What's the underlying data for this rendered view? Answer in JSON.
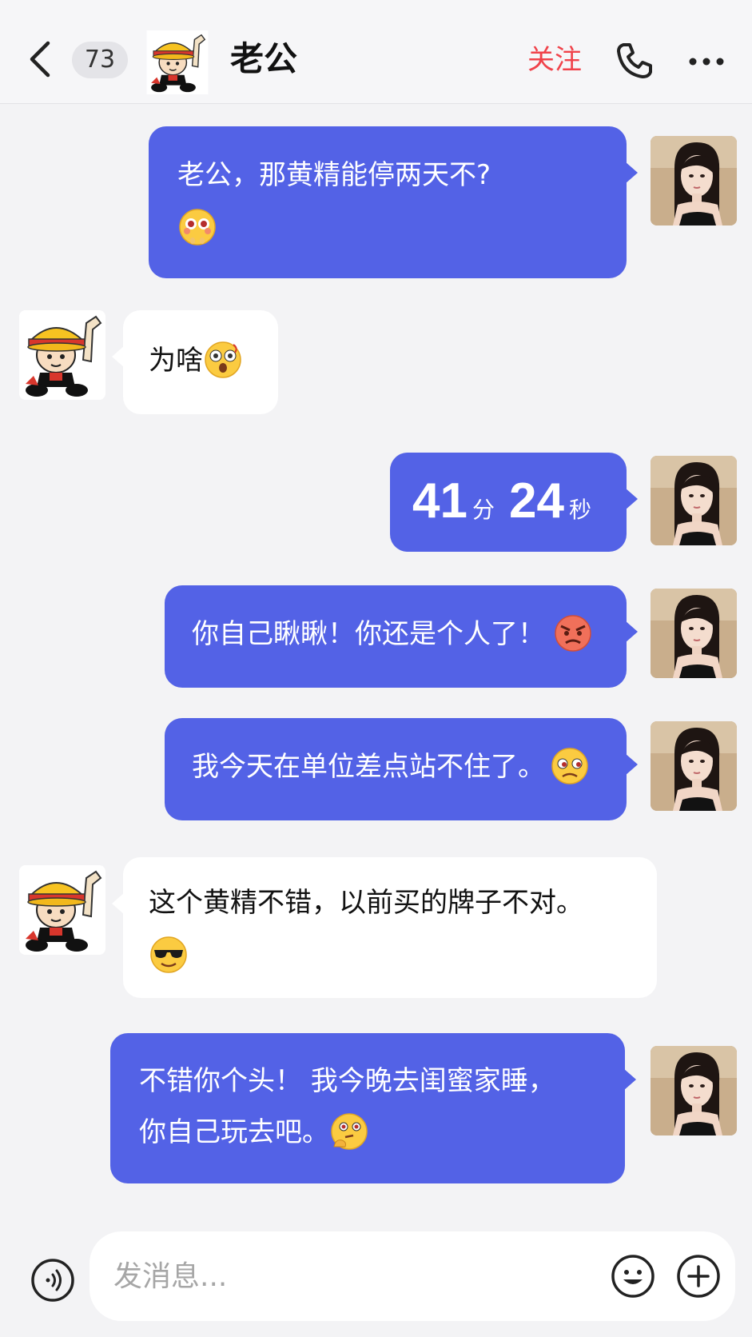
{
  "header": {
    "unread_count": "73",
    "title": "老公",
    "follow_label": "关注"
  },
  "messages": [
    {
      "sender": "me",
      "lines": [
        "老公，那黄精能停两天不?"
      ],
      "emoji": "flushed-face"
    },
    {
      "sender": "him",
      "text": "为啥",
      "emoji": "astonished-face"
    },
    {
      "sender": "me",
      "call_duration": {
        "minutes": "41",
        "minutes_unit": "分",
        "seconds": "24",
        "seconds_unit": "秒"
      }
    },
    {
      "sender": "me",
      "text": "你自己瞅瞅！你还是个人了！",
      "emoji": "angry-face"
    },
    {
      "sender": "me",
      "text": "我今天在单位差点站不住了。",
      "emoji": "sad-face"
    },
    {
      "sender": "him",
      "lines": [
        "这个黄精不错，以前买的牌子不对。"
      ],
      "emoji": "sunglasses-face"
    },
    {
      "sender": "me",
      "lines": [
        "不错你个头！ 我今晚去闺蜜家睡，",
        "你自己玩去吧。"
      ],
      "emoji": "thinking-face"
    }
  ],
  "input": {
    "placeholder": "发消息..."
  },
  "colors": {
    "my_bubble": "#5362e6",
    "other_bubble": "#ffffff",
    "follow": "#f0424a"
  }
}
